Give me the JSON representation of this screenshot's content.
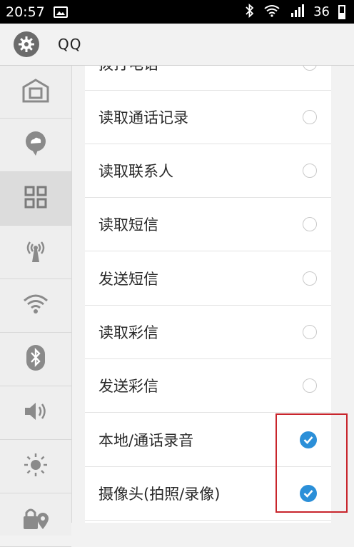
{
  "status_bar": {
    "time": "20:57",
    "battery_level": "36",
    "icons": [
      "picture-icon",
      "bluetooth-icon",
      "wifi-icon",
      "signal-icon",
      "battery-icon"
    ]
  },
  "header": {
    "title": "QQ",
    "icon": "gear-icon"
  },
  "sidebar": {
    "items": [
      {
        "icon": "home-icon",
        "active": false
      },
      {
        "icon": "cloud-chat-icon",
        "active": false
      },
      {
        "icon": "apps-grid-icon",
        "active": true
      },
      {
        "icon": "broadcast-antenna-icon",
        "active": false
      },
      {
        "icon": "wifi-icon",
        "active": false
      },
      {
        "icon": "bluetooth-icon",
        "active": false
      },
      {
        "icon": "volume-icon",
        "active": false
      },
      {
        "icon": "brightness-icon",
        "active": false
      },
      {
        "icon": "location-lock-icon",
        "active": false
      }
    ]
  },
  "permissions": [
    {
      "label": "拨打电话",
      "checked": false
    },
    {
      "label": "读取通话记录",
      "checked": false
    },
    {
      "label": "读取联系人",
      "checked": false
    },
    {
      "label": "读取短信",
      "checked": false
    },
    {
      "label": "发送短信",
      "checked": false
    },
    {
      "label": "读取彩信",
      "checked": false
    },
    {
      "label": "发送彩信",
      "checked": false
    },
    {
      "label": "本地/通话录音",
      "checked": true
    },
    {
      "label": "摄像头(拍照/录像)",
      "checked": true
    }
  ],
  "colors": {
    "accent": "#2b8fd8",
    "highlight": "#c8252c"
  }
}
